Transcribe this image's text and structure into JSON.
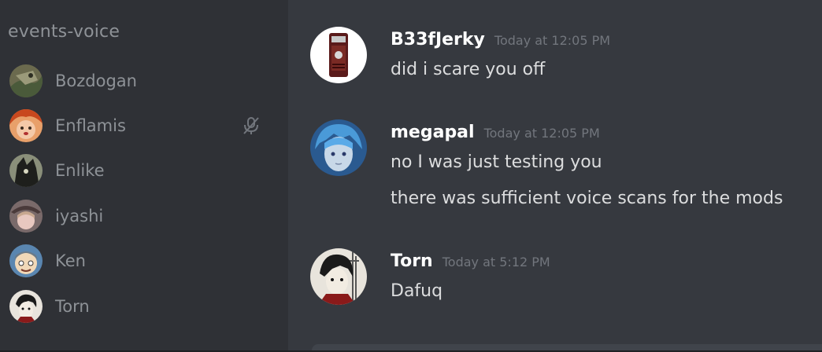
{
  "sidebar": {
    "channel_name": "events-voice",
    "users": [
      {
        "name": "Bozdogan",
        "avatar": "avatar-bozdogan",
        "muted": false
      },
      {
        "name": "Enflamis",
        "avatar": "avatar-enflamis",
        "muted": true
      },
      {
        "name": "Enlike",
        "avatar": "avatar-enlike",
        "muted": false
      },
      {
        "name": "iyashi",
        "avatar": "avatar-iyashi",
        "muted": false
      },
      {
        "name": "Ken",
        "avatar": "avatar-ken",
        "muted": false
      },
      {
        "name": "Torn",
        "avatar": "avatar-torn",
        "muted": false
      }
    ]
  },
  "messages": [
    {
      "author": "B33fJerky",
      "timestamp": "Today at 12:05 PM",
      "lines": [
        "did i scare you off"
      ]
    },
    {
      "author": "megapal",
      "timestamp": "Today at 12:05 PM",
      "lines": [
        "no I was just testing you",
        "there was sufficient voice scans for the mods"
      ]
    },
    {
      "author": "Torn",
      "timestamp": "Today at 5:12 PM",
      "lines": [
        "Dafuq"
      ]
    }
  ],
  "colors": {
    "sidebar_bg": "#2f3136",
    "chat_bg": "#36393f",
    "username": "#ffffff",
    "message_text": "#dcddde",
    "muted_text": "#8e9297",
    "timestamp": "#72767d"
  }
}
